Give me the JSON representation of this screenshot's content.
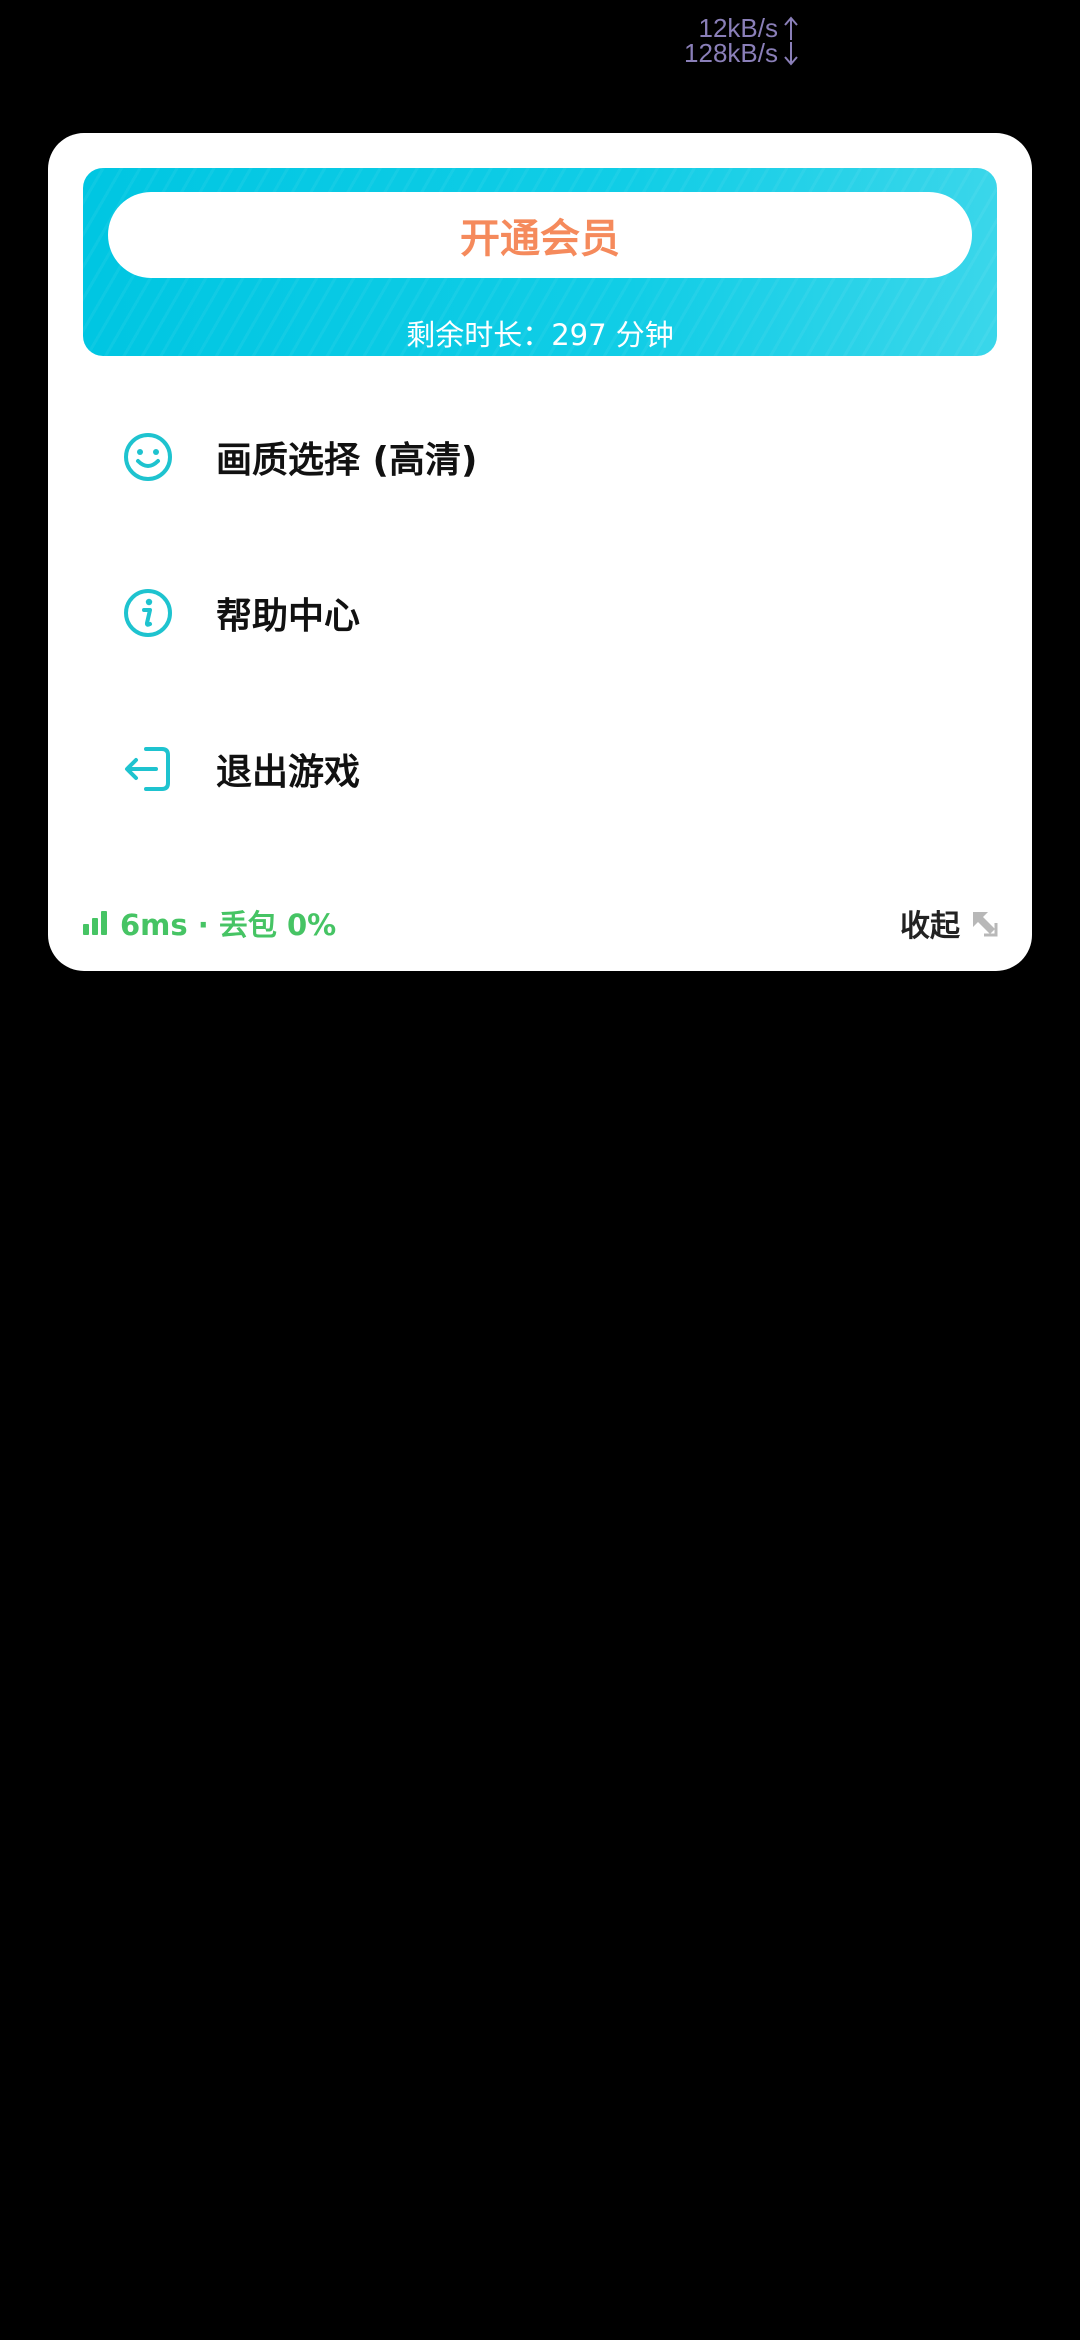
{
  "status_bar": {
    "upload_speed": "12kB/s",
    "download_speed": "128kB/s"
  },
  "member": {
    "button_label": "开通会员",
    "remaining_time": "剩余时长：297 分钟"
  },
  "menu": {
    "items": [
      {
        "label": "画质选择 (高清)",
        "icon": "smiley-face-icon"
      },
      {
        "label": "帮助中心",
        "icon": "info-icon"
      },
      {
        "label": "退出游戏",
        "icon": "exit-icon"
      }
    ]
  },
  "footer": {
    "network_status": "6ms · 丢包 0%",
    "collapse_label": "收起"
  },
  "colors": {
    "accent": "#1ec3cf",
    "banner": "#00c6e2",
    "member_text": "#f58a5c",
    "network_ok": "#46c464"
  }
}
